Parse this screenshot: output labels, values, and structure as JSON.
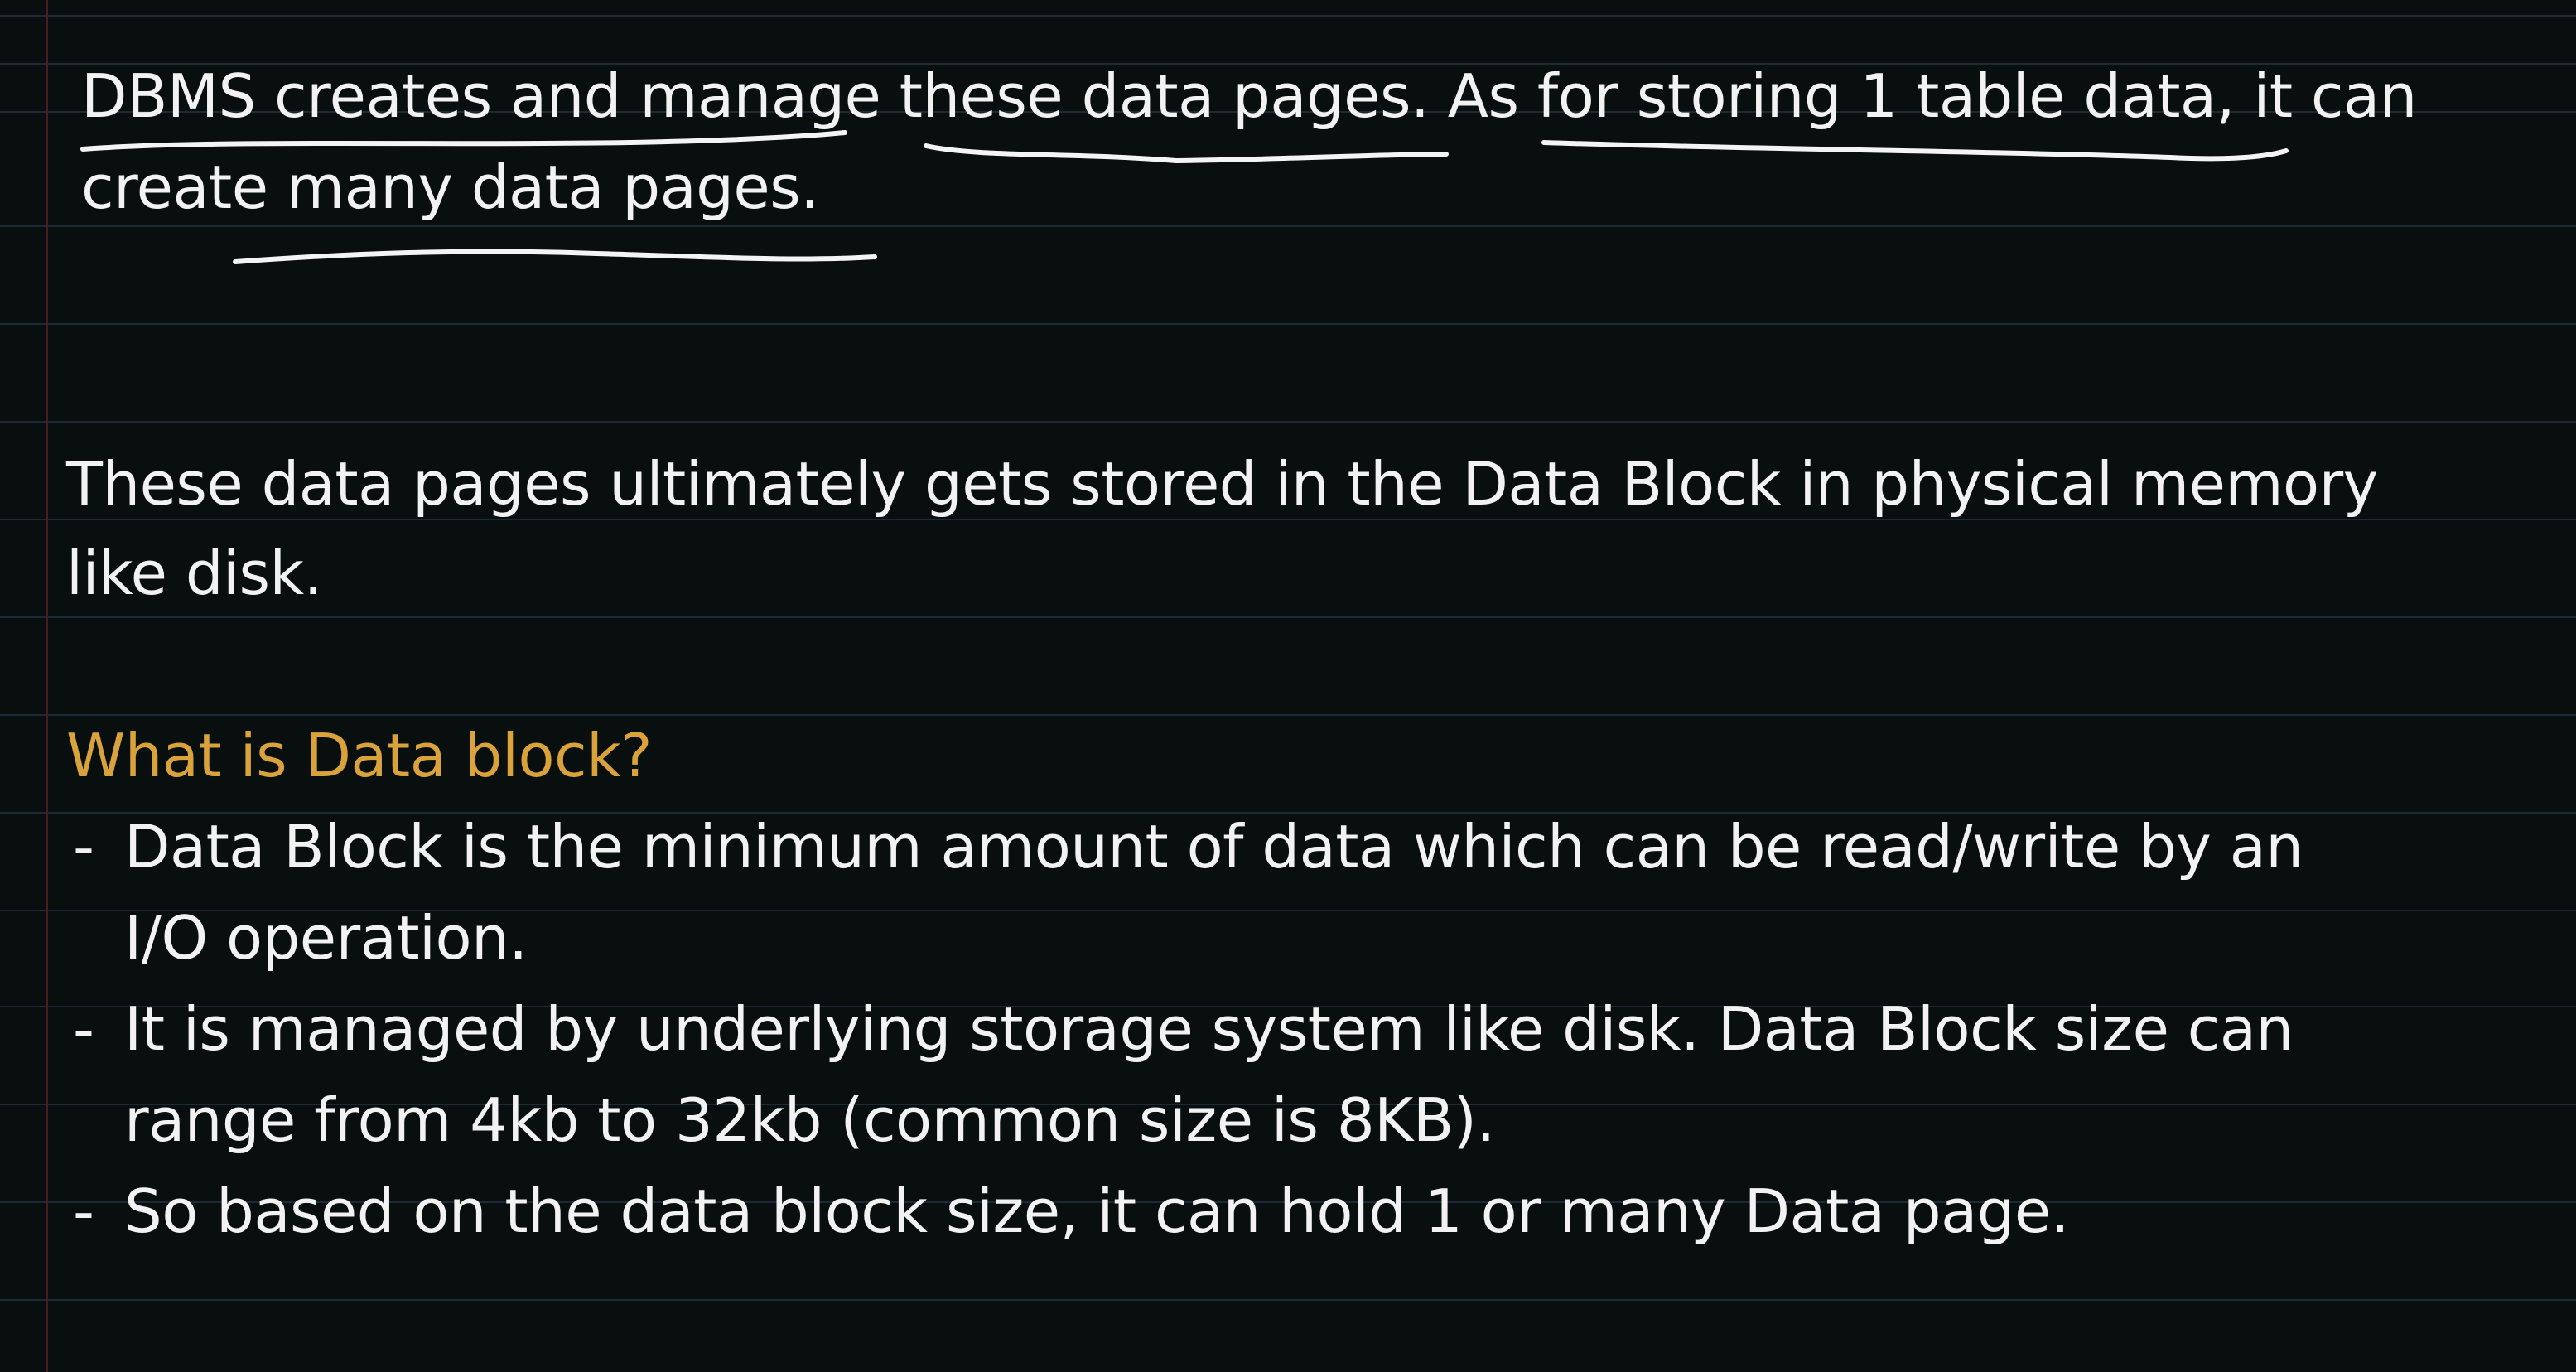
{
  "paragraph1": {
    "line1": "DBMS creates and manage these data pages. As for storing 1 table data, it can",
    "line2": "create many data pages."
  },
  "paragraph2": {
    "line1": "These data pages ultimately gets stored in the Data Block in physical memory",
    "line2": "like disk."
  },
  "section": {
    "heading": "What is Data block?",
    "heading_color": "#d9a23a",
    "bullet_marker": "-",
    "bullets": [
      {
        "line1": "Data Block is the minimum amount of data which can be read/write by an",
        "line2": "I/O operation."
      },
      {
        "line1": "It is managed by underlying storage system like disk. Data Block size can",
        "line2": "range from 4kb to 32kb (common size is 8KB)."
      },
      {
        "line1": "So based on the data block size, it can hold 1 or many Data page."
      }
    ]
  },
  "colors": {
    "background": "#090e0f",
    "text": "#f2f2f2",
    "rule_lines": "#1b2a36",
    "annotation_ink": "#f4f4f4"
  }
}
